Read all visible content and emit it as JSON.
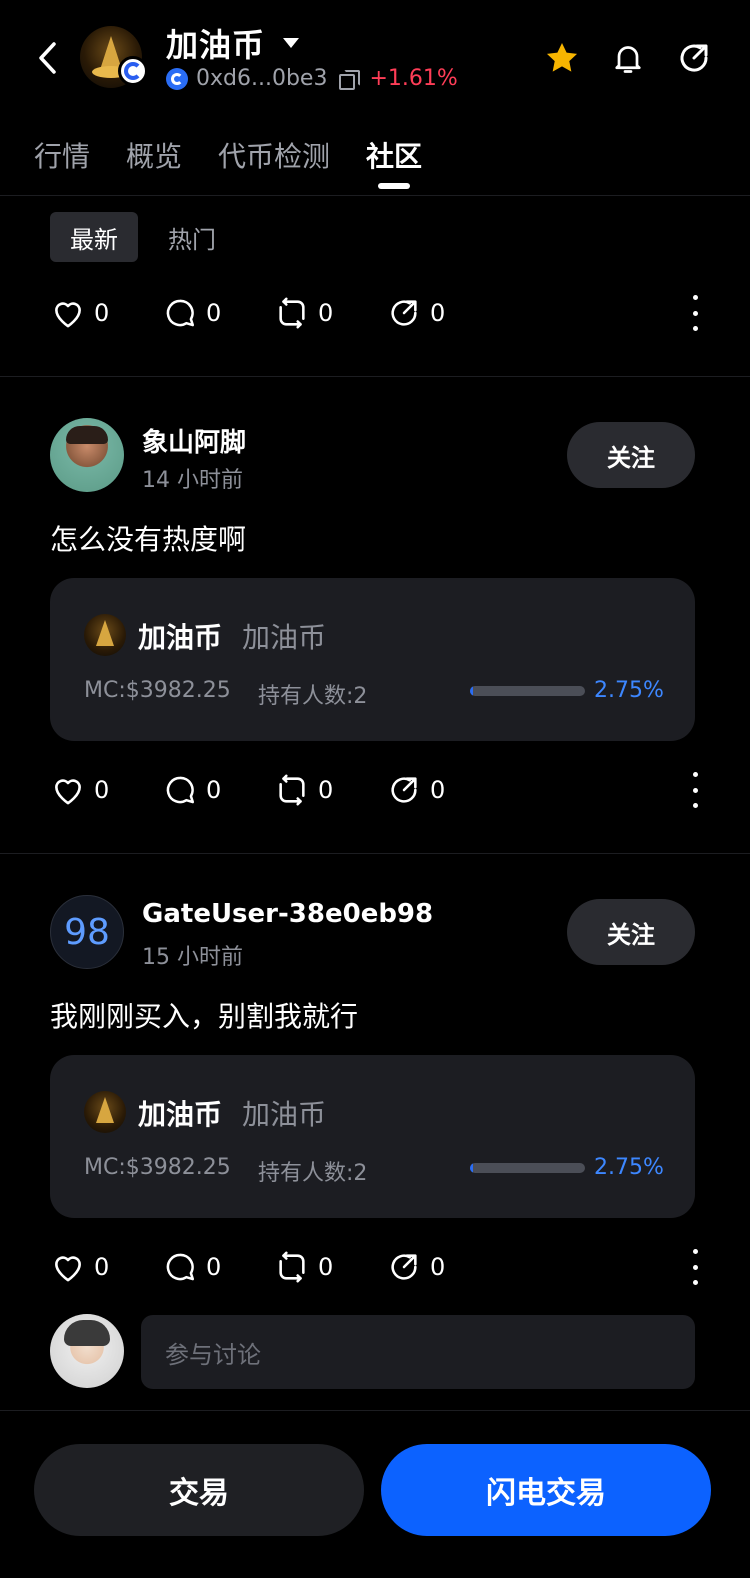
{
  "header": {
    "token_name": "加油币",
    "address": "0xd6...0be3",
    "change": "+1.61%",
    "colors": {
      "positive": "#ff3d57",
      "accent": "#0c62ff",
      "star": "#f7b500"
    },
    "icons": [
      "back-arrow-icon",
      "star-icon",
      "bell-icon",
      "share-icon",
      "copy-icon"
    ]
  },
  "tabs": [
    {
      "label": "行情"
    },
    {
      "label": "概览"
    },
    {
      "label": "代币检测"
    },
    {
      "label": "社区",
      "active": true
    }
  ],
  "filters": [
    {
      "label": "最新",
      "active": true
    },
    {
      "label": "热门"
    }
  ],
  "top_actions": {
    "likes": "0",
    "comments": "0",
    "reposts": "0",
    "shares": "0"
  },
  "posts": [
    {
      "user": "象山阿脚",
      "time": "14 小时前",
      "follow": "关注",
      "text": "怎么没有热度啊",
      "card": {
        "name": "加油币",
        "symbol": "加油币",
        "mc": "MC:$3982.25",
        "holders": "持有人数:2",
        "percent": "2.75%",
        "progress": 0.0275
      },
      "actions": {
        "likes": "0",
        "comments": "0",
        "reposts": "0",
        "shares": "0"
      }
    },
    {
      "user": "GateUser-38e0eb98",
      "avatar_text": "98",
      "time": "15 小时前",
      "follow": "关注",
      "text": "我刚刚买入，别割我就行",
      "card": {
        "name": "加油币",
        "symbol": "加油币",
        "mc": "MC:$3982.25",
        "holders": "持有人数:2",
        "percent": "2.75%",
        "progress": 0.0275
      },
      "actions": {
        "likes": "0",
        "comments": "0",
        "reposts": "0",
        "shares": "0"
      }
    }
  ],
  "comment": {
    "placeholder": "参与讨论"
  },
  "bottom": {
    "trade": "交易",
    "flash_trade": "闪电交易"
  }
}
